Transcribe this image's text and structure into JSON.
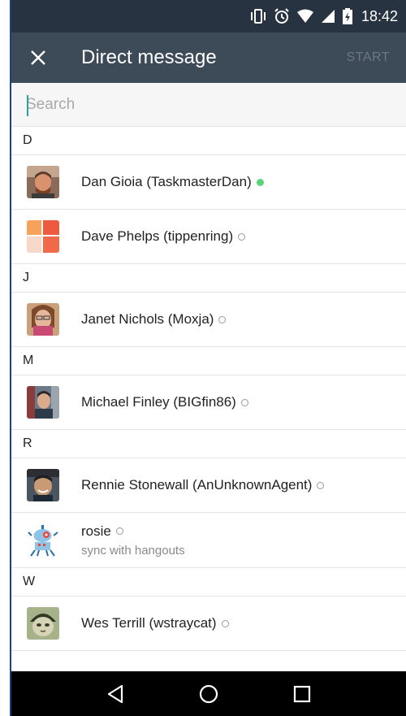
{
  "status_bar": {
    "time": "18:42",
    "icons": [
      "vibrate-icon",
      "alarm-icon",
      "wifi-icon",
      "signal-icon",
      "battery-charging-icon"
    ]
  },
  "app_bar": {
    "title": "Direct message",
    "close_icon": "close-icon",
    "start_label": "START"
  },
  "search": {
    "placeholder": "Search",
    "value": ""
  },
  "sections": [
    {
      "letter": "D",
      "contacts": [
        {
          "name": "Dan Gioia (TaskmasterDan)",
          "status": "active",
          "avatar": "photo-man-beard"
        },
        {
          "name": "Dave Phelps (tippenring)",
          "status": "away",
          "avatar": "orange-tiles-logo"
        }
      ]
    },
    {
      "letter": "J",
      "contacts": [
        {
          "name": "Janet Nichols (Moxja)",
          "status": "away",
          "avatar": "photo-woman-glasses"
        }
      ]
    },
    {
      "letter": "M",
      "contacts": [
        {
          "name": "Michael Finley (BIGfin86)",
          "status": "away",
          "avatar": "photo-man-outdoors"
        }
      ]
    },
    {
      "letter": "R",
      "contacts": [
        {
          "name": "Rennie Stonewall (AnUnknownAgent)",
          "status": "away",
          "avatar": "photo-man-smiling"
        },
        {
          "name": "rosie",
          "subtitle": "sync with hangouts",
          "status": "away",
          "avatar": "robot-icon"
        }
      ]
    },
    {
      "letter": "W",
      "contacts": [
        {
          "name": "Wes Terrill (wstraycat)",
          "status": "away",
          "avatar": "photo-cat-hat"
        }
      ]
    }
  ],
  "nav_bar": {
    "buttons": [
      "back-icon",
      "home-icon",
      "recents-icon"
    ]
  },
  "colors": {
    "status_bar": "#273341",
    "app_bar": "#3d4a58",
    "accent_cursor": "#29a3a0",
    "presence_active": "#5cd27a",
    "frame_line": "#1f3f83"
  }
}
